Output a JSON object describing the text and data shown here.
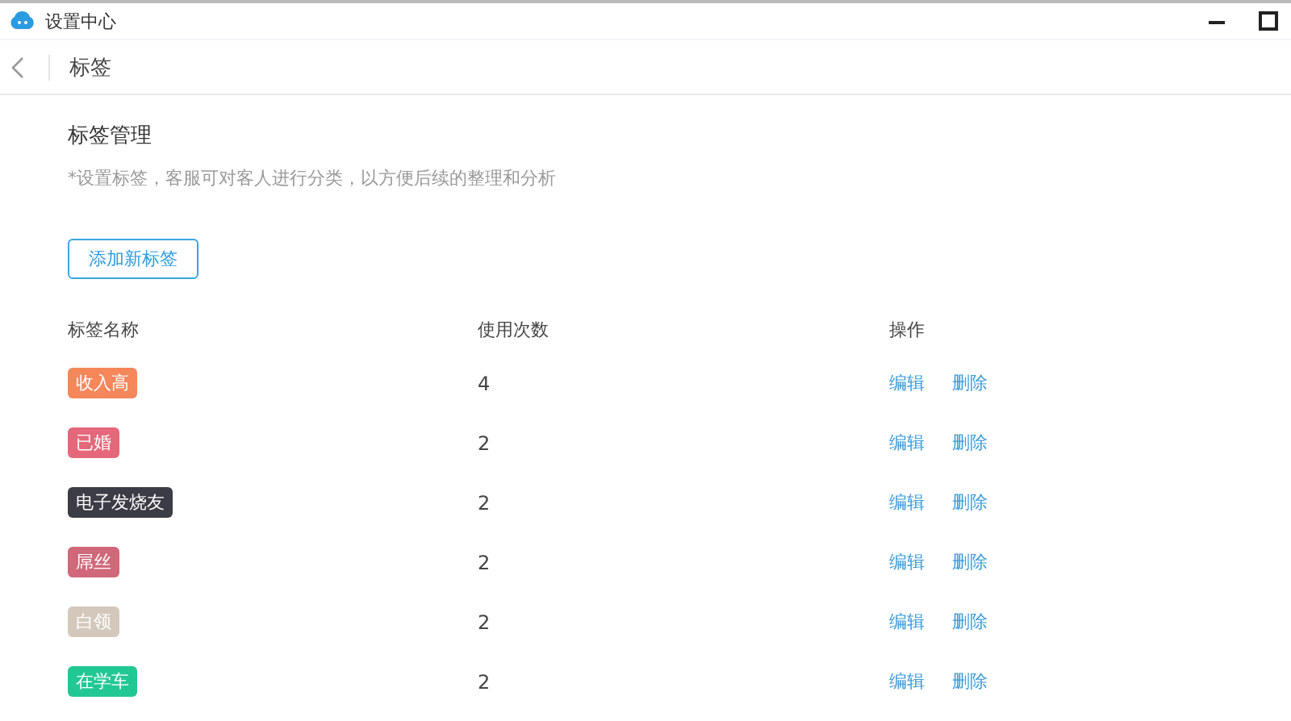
{
  "window": {
    "title": "设置中心"
  },
  "header": {
    "title": "标签"
  },
  "section": {
    "title": "标签管理",
    "hint": "*设置标签，客服可对客人进行分类，以方便后续的整理和分析",
    "add_button": "添加新标签"
  },
  "table": {
    "columns": [
      "标签名称",
      "使用次数",
      "操作"
    ],
    "rows": [
      {
        "tag": "收入高",
        "color": "#f5875a",
        "count": "4",
        "actions": [
          "编辑",
          "删除"
        ]
      },
      {
        "tag": "已婚",
        "color": "#e4687a",
        "count": "2",
        "actions": [
          "编辑",
          "删除"
        ]
      },
      {
        "tag": "电子发烧友",
        "color": "#3c3c46",
        "count": "2",
        "actions": [
          "编辑",
          "删除"
        ]
      },
      {
        "tag": "屌丝",
        "color": "#d0687a",
        "count": "2",
        "actions": [
          "编辑",
          "删除"
        ]
      },
      {
        "tag": "白领",
        "color": "#d4c8bc",
        "count": "2",
        "actions": [
          "编辑",
          "删除"
        ]
      },
      {
        "tag": "在学车",
        "color": "#22c894",
        "count": "2",
        "actions": [
          "编辑",
          "删除"
        ]
      }
    ]
  }
}
